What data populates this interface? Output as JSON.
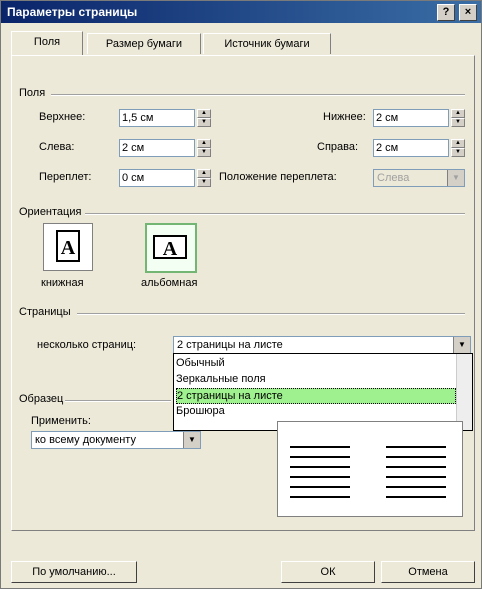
{
  "window": {
    "title": "Параметры страницы",
    "help_label": "?",
    "close_label": "×"
  },
  "tabs": [
    {
      "label": "Поля"
    },
    {
      "label": "Размер бумаги"
    },
    {
      "label": "Источник бумаги"
    }
  ],
  "margins": {
    "header": "Поля",
    "top_label": "Верхнее:",
    "top_value": "1,5 см",
    "bottom_label": "Нижнее:",
    "bottom_value": "2 см",
    "left_label": "Слева:",
    "left_value": "2 см",
    "right_label": "Справа:",
    "right_value": "2 см",
    "gutter_label": "Переплет:",
    "gutter_value": "0 см",
    "gutter_pos_label": "Положение переплета:",
    "gutter_pos_value": "Слева"
  },
  "orientation": {
    "header": "Ориентация",
    "portrait_label": "книжная",
    "landscape_label": "альбомная",
    "portrait_glyph": "A",
    "landscape_glyph": "A"
  },
  "pages": {
    "header": "Страницы",
    "multiple_label": "несколько страниц:",
    "multiple_value": "2 страницы на листе",
    "options": [
      "Обычный",
      "Зеркальные поля",
      "2 страницы на листе",
      "Брошюра"
    ],
    "selected_index": 2
  },
  "preview": {
    "header": "Образец",
    "apply_label": "Применить:",
    "apply_value": "ко всему документу"
  },
  "buttons": {
    "default": "По умолчанию...",
    "ok": "ОК",
    "cancel": "Отмена"
  }
}
